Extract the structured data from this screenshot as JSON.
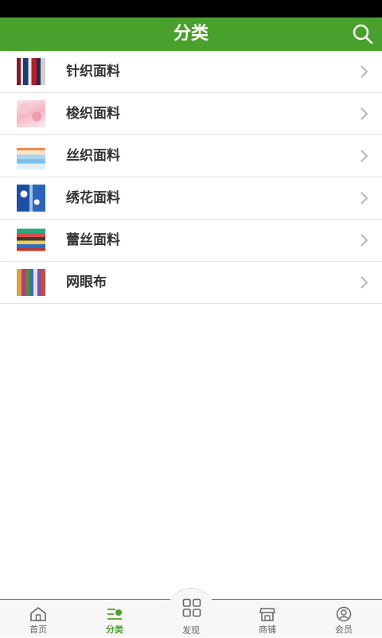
{
  "header": {
    "title": "分类",
    "search_icon": "search-icon"
  },
  "colors": {
    "brand": "#4aa02c",
    "status_bar": "#000000",
    "text": "#333333",
    "divider": "#e2e2e2"
  },
  "categories": [
    {
      "label": "针织面料",
      "thumb_icon": "fabric-rolls-thumbnail"
    },
    {
      "label": "梭织面料",
      "thumb_icon": "pink-fabric-thumbnail"
    },
    {
      "label": "丝织面料",
      "thumb_icon": "folded-silk-thumbnail"
    },
    {
      "label": "绣花面料",
      "thumb_icon": "blue-embroidery-thumbnail"
    },
    {
      "label": "蕾丝面料",
      "thumb_icon": "lace-stack-thumbnail"
    },
    {
      "label": "网眼布",
      "thumb_icon": "mesh-cloth-thumbnail"
    }
  ],
  "tabbar": {
    "tabs": [
      {
        "label": "首页",
        "icon": "home-icon",
        "active": false
      },
      {
        "label": "分类",
        "icon": "category-icon",
        "active": true
      },
      {
        "label": "发现",
        "icon": "grid-icon",
        "active": false
      },
      {
        "label": "商铺",
        "icon": "store-icon",
        "active": false
      },
      {
        "label": "会员",
        "icon": "user-icon",
        "active": false
      }
    ]
  }
}
